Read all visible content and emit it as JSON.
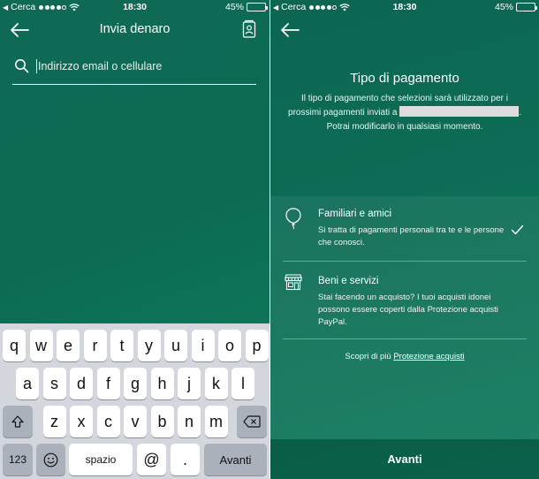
{
  "status_bar": {
    "carrier": "Cerca",
    "time": "18:30",
    "battery": "45%",
    "battery_level": 0.45
  },
  "left_screen": {
    "title": "Invia denaro",
    "search_placeholder": "Indirizzo email o cellulare",
    "keyboard": {
      "row1": [
        "q",
        "w",
        "e",
        "r",
        "t",
        "y",
        "u",
        "i",
        "o",
        "p"
      ],
      "row2": [
        "a",
        "s",
        "d",
        "f",
        "g",
        "h",
        "j",
        "k",
        "l"
      ],
      "row3": [
        "z",
        "x",
        "c",
        "v",
        "b",
        "n",
        "m"
      ],
      "numbers_key": "123",
      "space_key": "spazio",
      "at_key": "@",
      "dot_key": ".",
      "return_key": "Avanti"
    }
  },
  "right_screen": {
    "title": "Tipo di pagamento",
    "description_part1": "Il tipo di pagamento che selezioni sarà utilizzato per i prossimi pagamenti inviati a",
    "description_part2": ". Potrai modificarlo in qualsiasi momento.",
    "options": [
      {
        "name": "Familiari e amici",
        "description": "Si tratta di pagamenti personali tra te e le persone che conosci.",
        "selected": true,
        "icon": "balloon-icon"
      },
      {
        "name": "Beni e servizi",
        "description": "Stai facendo un acquisto? I tuoi acquisti idonei possono essere coperti dalla Protezione acquisti PayPal.",
        "selected": false,
        "icon": "storefront-icon"
      }
    ],
    "learn_more_text": "Scopri di più",
    "learn_more_link": "Protezione acquisti",
    "footer_button": "Avanti"
  }
}
